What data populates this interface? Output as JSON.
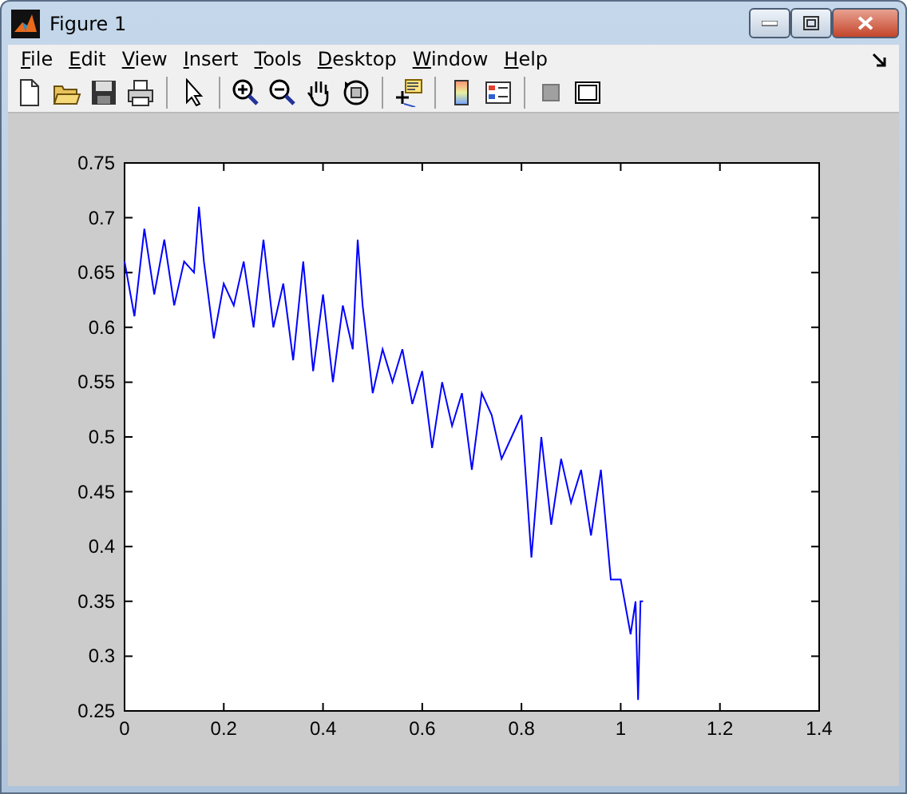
{
  "window": {
    "title": "Figure 1"
  },
  "menu": [
    "File",
    "Edit",
    "View",
    "Insert",
    "Tools",
    "Desktop",
    "Window",
    "Help"
  ],
  "toolbar": [
    {
      "kind": "new"
    },
    {
      "kind": "open"
    },
    {
      "kind": "save"
    },
    {
      "kind": "print"
    },
    {
      "kind": "sep"
    },
    {
      "kind": "pointer"
    },
    {
      "kind": "sep"
    },
    {
      "kind": "zoomin"
    },
    {
      "kind": "zoomout"
    },
    {
      "kind": "pan"
    },
    {
      "kind": "rotate"
    },
    {
      "kind": "sep"
    },
    {
      "kind": "datacursor"
    },
    {
      "kind": "sep"
    },
    {
      "kind": "colorbar"
    },
    {
      "kind": "legend"
    },
    {
      "kind": "sep"
    },
    {
      "kind": "hidetools"
    },
    {
      "kind": "showtools"
    }
  ],
  "figure": {
    "chart_data": {
      "type": "line",
      "xlim": [
        0,
        1.4
      ],
      "ylim": [
        0.25,
        0.75
      ],
      "xticks": [
        0,
        0.2,
        0.4,
        0.6,
        0.8,
        1,
        1.2,
        1.4
      ],
      "yticks": [
        0.25,
        0.3,
        0.35,
        0.4,
        0.45,
        0.5,
        0.55,
        0.6,
        0.65,
        0.7,
        0.75
      ],
      "x": [
        0,
        0.02,
        0.04,
        0.06,
        0.08,
        0.1,
        0.12,
        0.14,
        0.15,
        0.16,
        0.18,
        0.2,
        0.22,
        0.24,
        0.26,
        0.28,
        0.3,
        0.32,
        0.34,
        0.36,
        0.38,
        0.4,
        0.42,
        0.44,
        0.46,
        0.47,
        0.48,
        0.5,
        0.52,
        0.54,
        0.56,
        0.58,
        0.6,
        0.62,
        0.64,
        0.66,
        0.68,
        0.7,
        0.72,
        0.74,
        0.76,
        0.78,
        0.8,
        0.82,
        0.84,
        0.86,
        0.88,
        0.9,
        0.92,
        0.94,
        0.96,
        0.98,
        1,
        1.02,
        1.03,
        1.035,
        1.04,
        1.045
      ],
      "series": [
        {
          "color": "#0000ff",
          "values": [
            0.66,
            0.61,
            0.69,
            0.63,
            0.68,
            0.62,
            0.66,
            0.65,
            0.71,
            0.66,
            0.59,
            0.64,
            0.62,
            0.66,
            0.6,
            0.68,
            0.6,
            0.64,
            0.57,
            0.66,
            0.56,
            0.63,
            0.55,
            0.62,
            0.58,
            0.68,
            0.62,
            0.54,
            0.58,
            0.55,
            0.58,
            0.53,
            0.56,
            0.49,
            0.55,
            0.51,
            0.54,
            0.47,
            0.54,
            0.52,
            0.48,
            0.5,
            0.52,
            0.39,
            0.5,
            0.42,
            0.48,
            0.44,
            0.47,
            0.41,
            0.47,
            0.37,
            0.37,
            0.32,
            0.35,
            0.26,
            0.35,
            0.35
          ]
        }
      ]
    }
  }
}
